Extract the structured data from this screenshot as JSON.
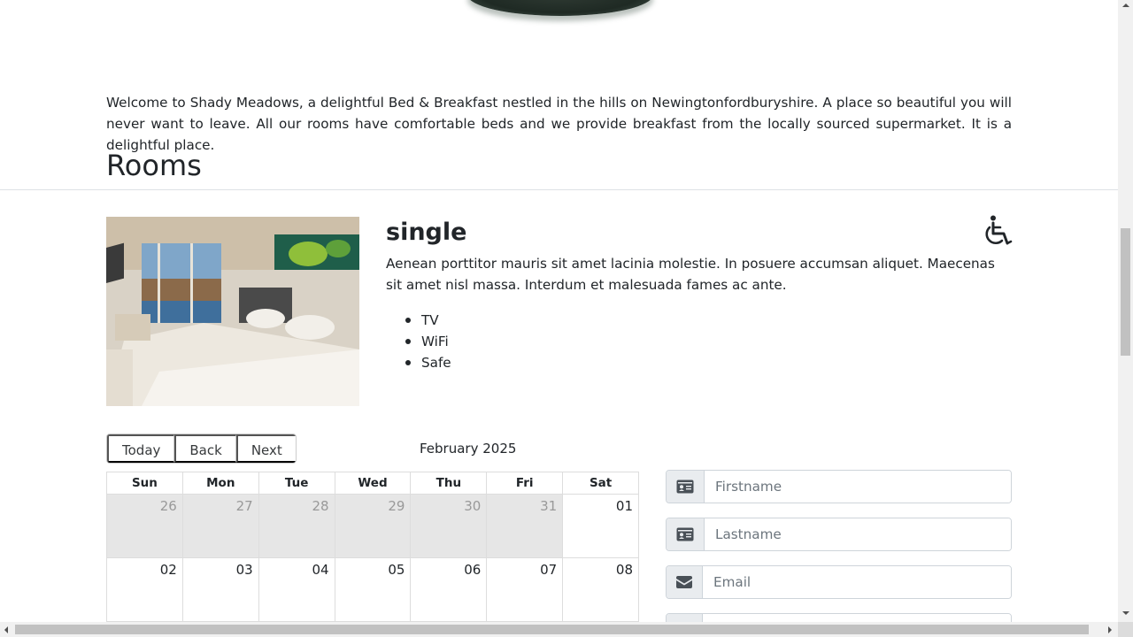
{
  "intro": {
    "welcome_text": "Welcome to Shady Meadows, a delightful Bed & Breakfast nestled in the hills on Newingtonfordburyshire. A place so beautiful you will never want to leave. All our rooms have comfortable beds and we provide breakfast from the locally sourced supermarket. It is a delightful place."
  },
  "rooms": {
    "heading": "Rooms",
    "room": {
      "type": "single",
      "accessible_icon": "wheelchair-icon",
      "description": "Aenean porttitor mauris sit amet lacinia molestie. In posuere accumsan aliquet. Maecenas sit amet nisl massa. Interdum et malesuada fames ac ante.",
      "amenities": [
        "TV",
        "WiFi",
        "Safe"
      ]
    }
  },
  "calendar": {
    "buttons": {
      "today": "Today",
      "back": "Back",
      "next": "Next"
    },
    "month_label": "February 2025",
    "weekdays": [
      "Sun",
      "Mon",
      "Tue",
      "Wed",
      "Thu",
      "Fri",
      "Sat"
    ],
    "weeks": [
      [
        "26",
        "27",
        "28",
        "29",
        "30",
        "31",
        "01"
      ],
      [
        "02",
        "03",
        "04",
        "05",
        "06",
        "07",
        "08"
      ]
    ]
  },
  "booking_form": {
    "firstname_placeholder": "Firstname",
    "lastname_placeholder": "Lastname",
    "email_placeholder": "Email",
    "firstname_icon": "id-card-icon",
    "lastname_icon": "id-card-icon",
    "email_icon": "envelope-icon"
  }
}
